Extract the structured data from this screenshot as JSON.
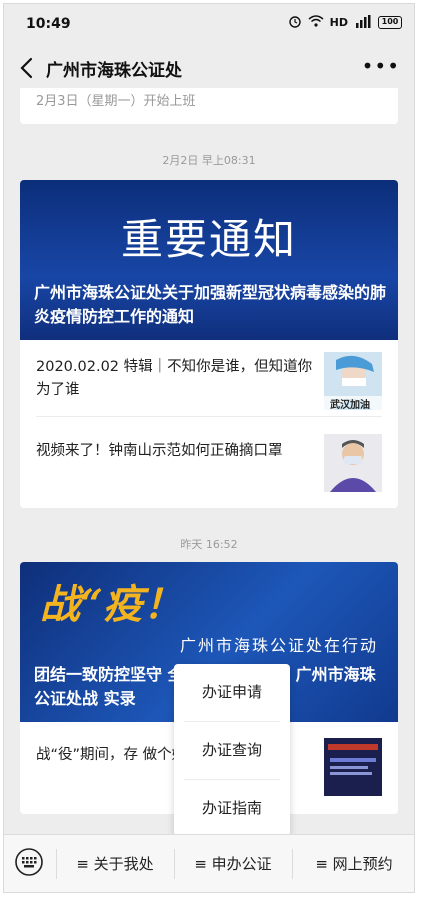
{
  "status": {
    "time": "10:49",
    "network": "HD",
    "signal": "4G",
    "battery": "100"
  },
  "nav": {
    "title": "广州市海珠公证处",
    "more": "•••"
  },
  "prev_card": {
    "text": "2月3日（星期一）开始上班"
  },
  "messages": [
    {
      "timestamp": "2月2日 早上08:31",
      "hero_big_text": "重要通知",
      "hero_title": "广州市海珠公证处关于加强新型冠状病毒感染的肺炎疫情防控工作的通知",
      "items": [
        {
          "text": "2020.02.02 特辑｜不知你是谁，但知道你为了谁",
          "thumb_caption": "武汉加油"
        },
        {
          "text": "视频来了！钟南山示范如何正确摘口罩"
        }
      ]
    },
    {
      "timestamp": "昨天 16:52",
      "hero_big_text": "战“疫！",
      "hero_sub_text": "广州市海珠公证处在行动",
      "hero_title": "团结一致防控坚守 全力以赴击疫情！广州市海珠公证处战 实录",
      "items": [
        {
          "text": "战“役”期间，存 做个好的狙击手！广州"
        }
      ]
    }
  ],
  "popup_menu": [
    "办证申请",
    "办证查询",
    "办证指南"
  ],
  "bottom_menu": [
    "≡ 关于我处",
    "≡ 申办公证",
    "≡ 网上预约"
  ]
}
